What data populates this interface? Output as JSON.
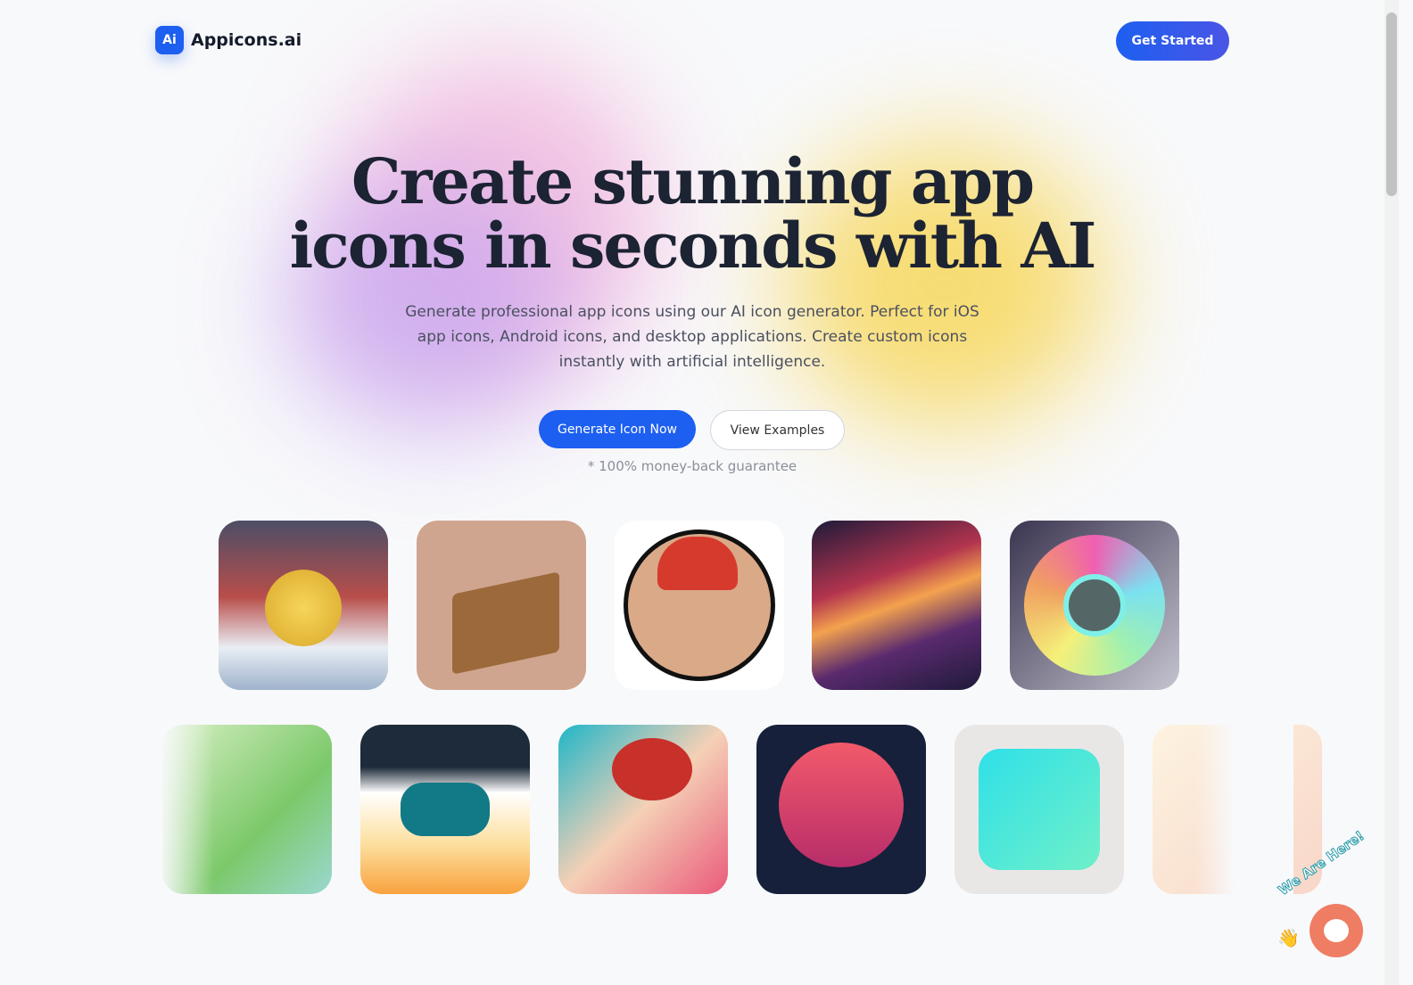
{
  "header": {
    "logo_badge": "Ai",
    "logo_text": "Appicons.ai",
    "cta": "Get Started"
  },
  "hero": {
    "title_line1": "Create stunning app",
    "title_line2": "icons in seconds with AI",
    "subtitle": "Generate professional app icons using our AI icon generator. Perfect for iOS app icons, Android icons, and desktop applications. Create custom icons instantly with artificial intelligence.",
    "primary_button": "Generate Icon Now",
    "secondary_button": "View Examples",
    "guarantee": "* 100% money-back guarantee"
  },
  "gallery": {
    "row1": [
      "moon-mountain-icon",
      "crate-machine-icon",
      "cartoon-boy-icon",
      "sunset-landscape-icon",
      "color-ring-icon"
    ],
    "row2": [
      "iguana-icon",
      "gamepad-icon",
      "red-hair-woman-icon",
      "samurai-sunset-icon",
      "brain-bulb-icon",
      "partial-icon"
    ]
  },
  "chat": {
    "label": "We Are Here!",
    "accent": "#ef7d63"
  },
  "colors": {
    "accent": "#1d5ff0",
    "text": "#1c2333"
  }
}
